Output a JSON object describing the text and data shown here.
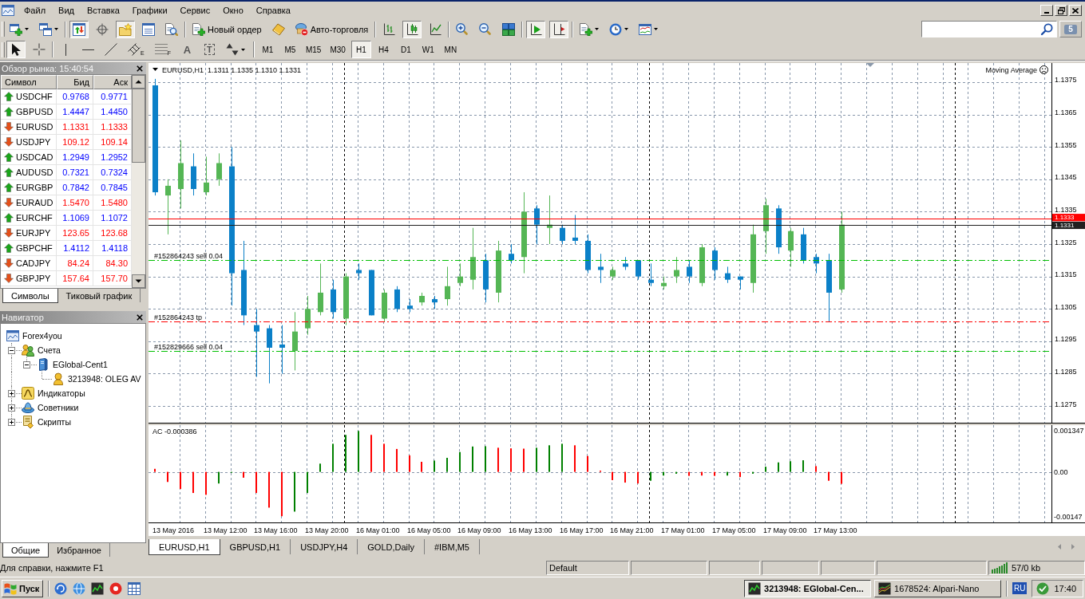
{
  "menu_bar": {
    "items": [
      "Файл",
      "Вид",
      "Вставка",
      "Графики",
      "Сервис",
      "Окно",
      "Справка"
    ]
  },
  "toolbar_main": {
    "groups": [
      [
        {
          "kind": "newchart",
          "pressed": false
        },
        {
          "kind": "profiles",
          "pressed": false
        }
      ],
      [
        {
          "kind": "marketwatch",
          "pressed": true
        },
        {
          "kind": "datawindow",
          "pressed": false
        },
        {
          "kind": "navigator",
          "pressed": true
        },
        {
          "kind": "terminal",
          "pressed": false
        },
        {
          "kind": "tester",
          "pressed": false
        }
      ],
      [
        {
          "kind": "order",
          "label": "Новый ордер",
          "pressed": false
        },
        {
          "kind": "editor",
          "pressed": false
        },
        {
          "kind": "autotrading",
          "label": "Авто-торговля",
          "pressed": false
        }
      ],
      [
        {
          "kind": "bars",
          "pressed": false
        },
        {
          "kind": "candles",
          "pressed": true
        },
        {
          "kind": "line",
          "pressed": false
        }
      ],
      [
        {
          "kind": "zoomin",
          "pressed": false
        },
        {
          "kind": "zoomout",
          "pressed": false
        },
        {
          "kind": "tile",
          "pressed": false
        }
      ],
      [
        {
          "kind": "autoscroll",
          "pressed": true
        },
        {
          "kind": "shift",
          "pressed": true
        }
      ],
      [
        {
          "kind": "indicators",
          "pressed": false
        },
        {
          "kind": "periods",
          "pressed": false
        },
        {
          "kind": "templates",
          "pressed": false
        }
      ]
    ]
  },
  "chat": {
    "count": "5"
  },
  "toolbar_tools": {
    "groups": [
      [
        {
          "kind": "cursor",
          "pressed": true
        },
        {
          "kind": "crosshair",
          "pressed": false
        }
      ],
      [
        {
          "kind": "vline",
          "pressed": false
        },
        {
          "kind": "hline",
          "pressed": false
        },
        {
          "kind": "trendline",
          "pressed": false
        },
        {
          "kind": "channel",
          "label": "E",
          "pressed": false
        },
        {
          "kind": "fibo",
          "label": "F",
          "pressed": false
        },
        {
          "kind": "text",
          "label": "A",
          "pressed": false
        },
        {
          "kind": "textlabel",
          "label": "T",
          "pressed": false
        },
        {
          "kind": "arrows",
          "pressed": false
        }
      ]
    ],
    "timeframes": [
      {
        "label": "M1",
        "selected": false
      },
      {
        "label": "M5",
        "selected": false
      },
      {
        "label": "M15",
        "selected": false
      },
      {
        "label": "M30",
        "selected": false
      },
      {
        "label": "H1",
        "selected": true
      },
      {
        "label": "H4",
        "selected": false
      },
      {
        "label": "D1",
        "selected": false
      },
      {
        "label": "W1",
        "selected": false
      },
      {
        "label": "MN",
        "selected": false
      }
    ]
  },
  "market_watch": {
    "title": "Обзор рынка: 15:40:54",
    "columns": [
      "Символ",
      "Бид",
      "Аск"
    ],
    "rows": [
      {
        "symbol": "USDCHF",
        "bid": "0.9768",
        "ask": "0.9771",
        "kind": "up"
      },
      {
        "symbol": "GBPUSD",
        "bid": "1.4447",
        "ask": "1.4450",
        "kind": "up"
      },
      {
        "symbol": "EURUSD",
        "bid": "1.1331",
        "ask": "1.1333",
        "kind": "down"
      },
      {
        "symbol": "USDJPY",
        "bid": "109.12",
        "ask": "109.14",
        "kind": "down"
      },
      {
        "symbol": "USDCAD",
        "bid": "1.2949",
        "ask": "1.2952",
        "kind": "up"
      },
      {
        "symbol": "AUDUSD",
        "bid": "0.7321",
        "ask": "0.7324",
        "kind": "up"
      },
      {
        "symbol": "EURGBP",
        "bid": "0.7842",
        "ask": "0.7845",
        "kind": "up"
      },
      {
        "symbol": "EURAUD",
        "bid": "1.5470",
        "ask": "1.5480",
        "kind": "down"
      },
      {
        "symbol": "EURCHF",
        "bid": "1.1069",
        "ask": "1.1072",
        "kind": "up"
      },
      {
        "symbol": "EURJPY",
        "bid": "123.65",
        "ask": "123.68",
        "kind": "down"
      },
      {
        "symbol": "GBPCHF",
        "bid": "1.4112",
        "ask": "1.4118",
        "kind": "up"
      },
      {
        "symbol": "CADJPY",
        "bid": "84.24",
        "ask": "84.30",
        "kind": "down"
      },
      {
        "symbol": "GBPJPY",
        "bid": "157.64",
        "ask": "157.70",
        "kind": "down"
      }
    ],
    "tabs": [
      {
        "label": "Символы",
        "selected": true
      },
      {
        "label": "Тиковый график",
        "selected": false
      }
    ]
  },
  "navigator": {
    "title": "Навигатор",
    "tree": [
      {
        "kind": "terminal",
        "label": "Forex4you",
        "children": [
          {
            "kind": "accounts",
            "label": "Счета",
            "expanded": true,
            "children": [
              {
                "kind": "server",
                "label": "EGlobal-Cent1",
                "expanded": true,
                "children": [
                  {
                    "kind": "account",
                    "label": "3213948: OLEG AV"
                  }
                ]
              }
            ]
          },
          {
            "kind": "indicators",
            "label": "Индикаторы",
            "expanded": false
          },
          {
            "kind": "experts",
            "label": "Советники",
            "expanded": false
          },
          {
            "kind": "scripts",
            "label": "Скрипты",
            "expanded": false
          }
        ]
      }
    ],
    "tabs": [
      {
        "label": "Общие",
        "selected": true
      },
      {
        "label": "Избранное",
        "selected": false
      }
    ]
  },
  "chart_window": {
    "expert": "Moving Average",
    "chart_data": [
      {
        "type": "candlestick",
        "title": "EURUSD,H1  1.1311 1.1335 1.1310 1.1331",
        "ylim": [
          1.12696,
          1.13809
        ],
        "yticks": [
          1.1275,
          1.1285,
          1.1295,
          1.1305,
          1.1315,
          1.1325,
          1.1335,
          1.1345,
          1.1355,
          1.1365,
          1.1375
        ],
        "grid": true,
        "ohlc": [
          [
            1.1374,
            1.1376,
            1.134,
            1.1341
          ],
          [
            1.134,
            1.1345,
            1.1328,
            1.1343
          ],
          [
            1.1342,
            1.1357,
            1.1336,
            1.135
          ],
          [
            1.1349,
            1.1353,
            1.134,
            1.1342
          ],
          [
            1.1341,
            1.1352,
            1.134,
            1.1344
          ],
          [
            1.1345,
            1.1353,
            1.1343,
            1.135
          ],
          [
            1.1349,
            1.1355,
            1.1306,
            1.1316
          ],
          [
            1.1317,
            1.1326,
            1.13,
            1.1303
          ],
          [
            1.13,
            1.1305,
            1.1284,
            1.1298
          ],
          [
            1.1299,
            1.13,
            1.1282,
            1.1293
          ],
          [
            1.1294,
            1.13,
            1.1285,
            1.1293
          ],
          [
            1.1292,
            1.1304,
            1.1286,
            1.1298
          ],
          [
            1.1299,
            1.1309,
            1.1297,
            1.1305
          ],
          [
            1.1304,
            1.1319,
            1.1303,
            1.131
          ],
          [
            1.1311,
            1.1314,
            1.1302,
            1.1304
          ],
          [
            1.1302,
            1.1316,
            1.13,
            1.1315
          ],
          [
            1.1317,
            1.1319,
            1.1314,
            1.1316
          ],
          [
            1.1317,
            1.1317,
            1.1303,
            1.1303
          ],
          [
            1.1302,
            1.1311,
            1.1301,
            1.131
          ],
          [
            1.1311,
            1.1312,
            1.1304,
            1.1305
          ],
          [
            1.1306,
            1.1308,
            1.1304,
            1.1305
          ],
          [
            1.1307,
            1.131,
            1.1306,
            1.1309
          ],
          [
            1.1308,
            1.1309,
            1.1305,
            1.1307
          ],
          [
            1.1308,
            1.1318,
            1.1306,
            1.1312
          ],
          [
            1.1313,
            1.1319,
            1.1312,
            1.1315
          ],
          [
            1.1314,
            1.133,
            1.1311,
            1.1321
          ],
          [
            1.132,
            1.1322,
            1.1307,
            1.1311
          ],
          [
            1.131,
            1.1326,
            1.1307,
            1.1323
          ],
          [
            1.1322,
            1.1325,
            1.1319,
            1.132
          ],
          [
            1.1321,
            1.1341,
            1.1316,
            1.1335
          ],
          [
            1.1336,
            1.1337,
            1.1325,
            1.1331
          ],
          [
            1.133,
            1.134,
            1.1325,
            1.1331
          ],
          [
            1.133,
            1.1331,
            1.1325,
            1.1326
          ],
          [
            1.1327,
            1.1334,
            1.1325,
            1.1326
          ],
          [
            1.1326,
            1.1328,
            1.1316,
            1.1317
          ],
          [
            1.1318,
            1.1322,
            1.1313,
            1.1317
          ],
          [
            1.1315,
            1.1318,
            1.1314,
            1.1317
          ],
          [
            1.1319,
            1.1321,
            1.1317,
            1.1318
          ],
          [
            1.132,
            1.132,
            1.1314,
            1.1315
          ],
          [
            1.1314,
            1.1319,
            1.1312,
            1.1313
          ],
          [
            1.1312,
            1.1315,
            1.1311,
            1.1313
          ],
          [
            1.1315,
            1.1321,
            1.1313,
            1.1317
          ],
          [
            1.1318,
            1.132,
            1.1313,
            1.1315
          ],
          [
            1.1313,
            1.1325,
            1.1312,
            1.1324
          ],
          [
            1.1323,
            1.1324,
            1.1314,
            1.1317
          ],
          [
            1.1316,
            1.1318,
            1.1313,
            1.1314
          ],
          [
            1.1315,
            1.1315,
            1.1311,
            1.1314
          ],
          [
            1.1313,
            1.1331,
            1.131,
            1.1328
          ],
          [
            1.1329,
            1.1339,
            1.1322,
            1.1337
          ],
          [
            1.1336,
            1.1337,
            1.1322,
            1.1324
          ],
          [
            1.1323,
            1.133,
            1.1318,
            1.1329
          ],
          [
            1.1328,
            1.133,
            1.1319,
            1.132
          ],
          [
            1.1321,
            1.1322,
            1.1316,
            1.1319
          ],
          [
            1.132,
            1.1322,
            1.1301,
            1.131
          ],
          [
            1.1311,
            1.1335,
            1.131,
            1.1331
          ],
          null,
          null,
          null,
          null,
          null,
          null,
          null,
          null,
          null,
          null,
          null,
          null,
          null,
          null,
          null,
          null
        ],
        "colors": [
          "#0b80c8",
          "#55b655",
          "#55b655",
          "#0b80c8",
          "#55b655",
          "#55b655",
          "#0b80c8",
          "#0b80c8",
          "#0b80c8",
          "#0b80c8",
          "#0b80c8",
          "#55b655",
          "#55b655",
          "#55b655",
          "#0b80c8",
          "#55b655",
          "#0b80c8",
          "#0b80c8",
          "#55b655",
          "#0b80c8",
          "#0b80c8",
          "#55b655",
          "#0b80c8",
          "#55b655",
          "#55b655",
          "#55b655",
          "#0b80c8",
          "#55b655",
          "#0b80c8",
          "#55b655",
          "#0b80c8",
          "#55b655",
          "#0b80c8",
          "#0b80c8",
          "#0b80c8",
          "#0b80c8",
          "#55b655",
          "#0b80c8",
          "#0b80c8",
          "#0b80c8",
          "#55b655",
          "#55b655",
          "#0b80c8",
          "#55b655",
          "#0b80c8",
          "#0b80c8",
          "#0b80c8",
          "#55b655",
          "#55b655",
          "#0b80c8",
          "#55b655",
          "#0b80c8",
          "#0b80c8",
          "#0b80c8",
          "#55b655",
          null,
          null,
          null,
          null,
          null,
          null,
          null,
          null,
          null,
          null,
          null,
          null,
          null,
          null,
          null,
          null
        ],
        "ref_lines": [
          {
            "axis": "y",
            "value": 1.1333,
            "label": "1.1333",
            "color": "#ff0000",
            "line_style": "solid"
          },
          {
            "axis": "y",
            "value": 1.1331,
            "label": "1.1331",
            "color": "#202020",
            "line_style": "solid"
          },
          {
            "axis": "y",
            "value": 1.132,
            "label": "#152864243 sell 0.04",
            "color": "#00c000",
            "line_style": "dashdot"
          },
          {
            "axis": "y",
            "value": 1.1301,
            "label": "#152864243 tp",
            "color": "#ff0000",
            "line_style": "dashdot"
          },
          {
            "axis": "y",
            "value": 1.1292,
            "label": "#152829666 sell 0.04",
            "color": "#00c000",
            "line_style": "dashdot"
          }
        ]
      },
      {
        "type": "bar",
        "title": "AC -0.000386",
        "ylim": [
          -0.00168,
          0.00153
        ],
        "yticks": [
          {
            "value": 0.001347,
            "label": "0.001347"
          },
          {
            "value": 0,
            "label": "0.00"
          },
          {
            "value": -0.00147,
            "label": "-0.00147"
          }
        ],
        "grid": "x",
        "values": [
          0.0001,
          -0.00033,
          -0.00056,
          -0.00069,
          -0.00075,
          -0.00038,
          -3e-05,
          -0.00019,
          -0.00069,
          -0.00117,
          -0.00145,
          -0.0013,
          -0.00069,
          0.00027,
          0.00092,
          0.00121,
          0.00134,
          0.00121,
          0.00092,
          0.00075,
          0.00054,
          0.00033,
          0.00037,
          0.00046,
          0.00065,
          0.00083,
          0.00084,
          0.00079,
          0.00077,
          0.00076,
          0.00079,
          0.00087,
          0.00092,
          0.00087,
          0.00052,
          4e-05,
          -0.00027,
          -0.00035,
          -0.00038,
          -0.00029,
          -0.00012,
          -6e-05,
          -0.00013,
          -0.00012,
          -0.00013,
          -0.00012,
          -0.00017,
          -6e-05,
          0.00017,
          0.00031,
          0.00035,
          0.00038,
          0.00019,
          -0.00029,
          -0.00039,
          null,
          null,
          null,
          null,
          null,
          null,
          null,
          null,
          null,
          null,
          null,
          null,
          null,
          null,
          null,
          null
        ],
        "colors": [
          "#ff0000",
          "#ff0000",
          "#ff0000",
          "#ff0000",
          "#ff0000",
          "#008000",
          "#008000",
          "#ff0000",
          "#ff0000",
          "#ff0000",
          "#ff0000",
          "#008000",
          "#008000",
          "#008000",
          "#008000",
          "#008000",
          "#008000",
          "#ff0000",
          "#ff0000",
          "#ff0000",
          "#ff0000",
          "#ff0000",
          "#008000",
          "#008000",
          "#008000",
          "#008000",
          "#008000",
          "#ff0000",
          "#ff0000",
          "#ff0000",
          "#008000",
          "#008000",
          "#008000",
          "#ff0000",
          "#ff0000",
          "#ff0000",
          "#ff0000",
          "#ff0000",
          "#ff0000",
          "#008000",
          "#008000",
          "#008000",
          "#ff0000",
          "#ff0000",
          "#ff0000",
          "#008000",
          "#ff0000",
          "#008000",
          "#008000",
          "#008000",
          "#008000",
          "#008000",
          "#ff0000",
          "#ff0000",
          "#ff0000",
          null,
          null,
          null,
          null,
          null,
          null,
          null,
          null,
          null,
          null,
          null,
          null,
          null,
          null,
          null,
          null
        ],
        "ref_lines": [
          {
            "axis": "y",
            "value": 0,
            "color": "#8796aa",
            "line_style": "dashed"
          }
        ]
      }
    ],
    "time_axis": [
      "13 May 2016",
      "13 May 12:00",
      "13 May 16:00",
      "13 May 20:00",
      "16 May 01:00",
      "16 May 05:00",
      "16 May 09:00",
      "16 May 13:00",
      "16 May 17:00",
      "16 May 21:00",
      "17 May 01:00",
      "17 May 05:00",
      "17 May 09:00",
      "17 May 13:00"
    ],
    "tabs": [
      {
        "label": "EURUSD,H1",
        "selected": true
      },
      {
        "label": "GBPUSD,H1",
        "selected": false
      },
      {
        "label": "USDJPY,H4",
        "selected": false
      },
      {
        "label": "GOLD,Daily",
        "selected": false
      },
      {
        "label": "#IBM,M5",
        "selected": false
      }
    ]
  },
  "status_bar": {
    "help": "Для справки, нажмите F1",
    "profile": "Default",
    "traffic": "57/0 kb"
  },
  "taskbar": {
    "start": "Пуск",
    "tasks": [
      {
        "label": "3213948: EGlobal-Cen...",
        "selected": true
      },
      {
        "label": "1678524: Alpari-Nano",
        "selected": false
      }
    ],
    "language": "RU",
    "clock": "17:40"
  }
}
